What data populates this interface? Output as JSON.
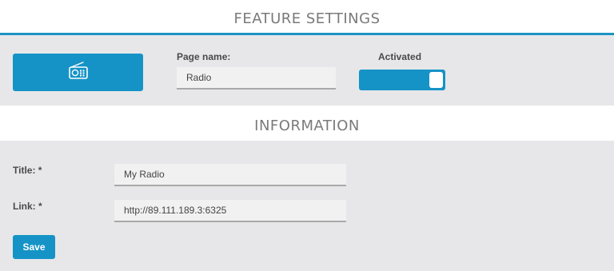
{
  "colors": {
    "accent": "#1593c7",
    "panel_bg": "#e7e7e9",
    "header_text": "#7a7a7a"
  },
  "feature_settings": {
    "header": "FEATURE SETTINGS",
    "icon": "radio-icon",
    "page_name_label": "Page name:",
    "page_name_value": "Radio",
    "activated_label": "Activated",
    "activated": true
  },
  "information": {
    "header": "INFORMATION",
    "title_label": "Title: *",
    "title_value": "My Radio",
    "link_label": "Link: *",
    "link_value": "http://89.111.189.3:6325",
    "save_label": "Save"
  }
}
